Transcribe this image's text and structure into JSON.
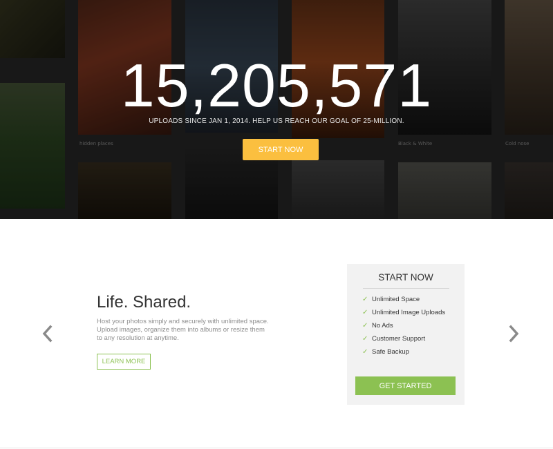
{
  "hero": {
    "counter": "15,205,571",
    "subtitle": "UPLOADS SINCE JAN 1, 2014. HELP US REACH OUR GOAL OF 25-MILLION.",
    "cta_label": "START NOW",
    "cta_color": "#fbbf3f",
    "background_captions": [
      "hidden places",
      "Black & White",
      "Cold nose"
    ]
  },
  "promo": {
    "headline": "Life. Shared.",
    "description": "Host your photos simply and securely with unlimited space. Upload images, organize them into albums or resize them to any resolution at anytime.",
    "learn_more_label": "LEARN MORE",
    "prev_icon": "chevron-left-icon",
    "next_icon": "chevron-right-icon"
  },
  "pricing_card": {
    "title": "START NOW",
    "features": [
      "Unlimited Space",
      "Unlimited Image Uploads",
      "No Ads",
      "Customer Support",
      "Safe Backup"
    ],
    "check_icon": "check-icon",
    "cta_label": "GET STARTED",
    "accent_color": "#8cc152"
  }
}
